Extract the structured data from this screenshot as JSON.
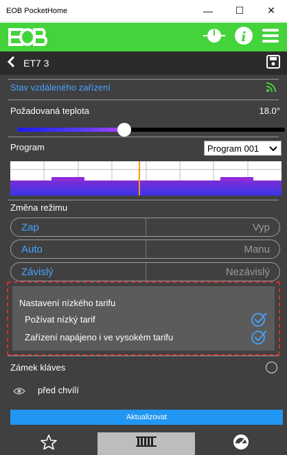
{
  "window": {
    "title": "EOB PocketHome",
    "minimize": "—",
    "maximize": "☐",
    "close": "✕"
  },
  "header": {
    "device_title": "ET7 3"
  },
  "remote_status": {
    "label": "Stav vzdáleného zařízení"
  },
  "temperature": {
    "label": "Požadovaná teplota",
    "value": "18.0°",
    "level_fraction": 0.39
  },
  "program": {
    "label": "Program",
    "selected": "Program 001"
  },
  "mode": {
    "label": "Změna režimu",
    "rows": [
      {
        "active": "Zap",
        "inactive": "Vyp"
      },
      {
        "active": "Auto",
        "inactive": "Manu"
      },
      {
        "active": "Závislý",
        "inactive": "Nezávislý"
      }
    ]
  },
  "tariff": {
    "title": "Nastavení nízkého tarifu",
    "use_low": "Požívat nízký tarif",
    "powered_high": "Zařízení napájeno i ve vysokém tarifu"
  },
  "key_lock": {
    "label": "Zámek kláves"
  },
  "last_update": {
    "text": "před chvílí"
  },
  "update_button": {
    "label": "Aktualizovat"
  },
  "colors": {
    "brand_green": "#45d33c",
    "accent_blue": "#46a3ff",
    "button_blue": "#2196f3",
    "highlight_red": "#d32f2f"
  },
  "icons": [
    "logo",
    "thermostat-icon",
    "info-icon",
    "menu-icon",
    "back-icon",
    "save-icon",
    "signal-icon",
    "chevron-down-icon",
    "check-icon",
    "eye-icon",
    "star-icon",
    "radiator-icon",
    "gauge-icon"
  ]
}
